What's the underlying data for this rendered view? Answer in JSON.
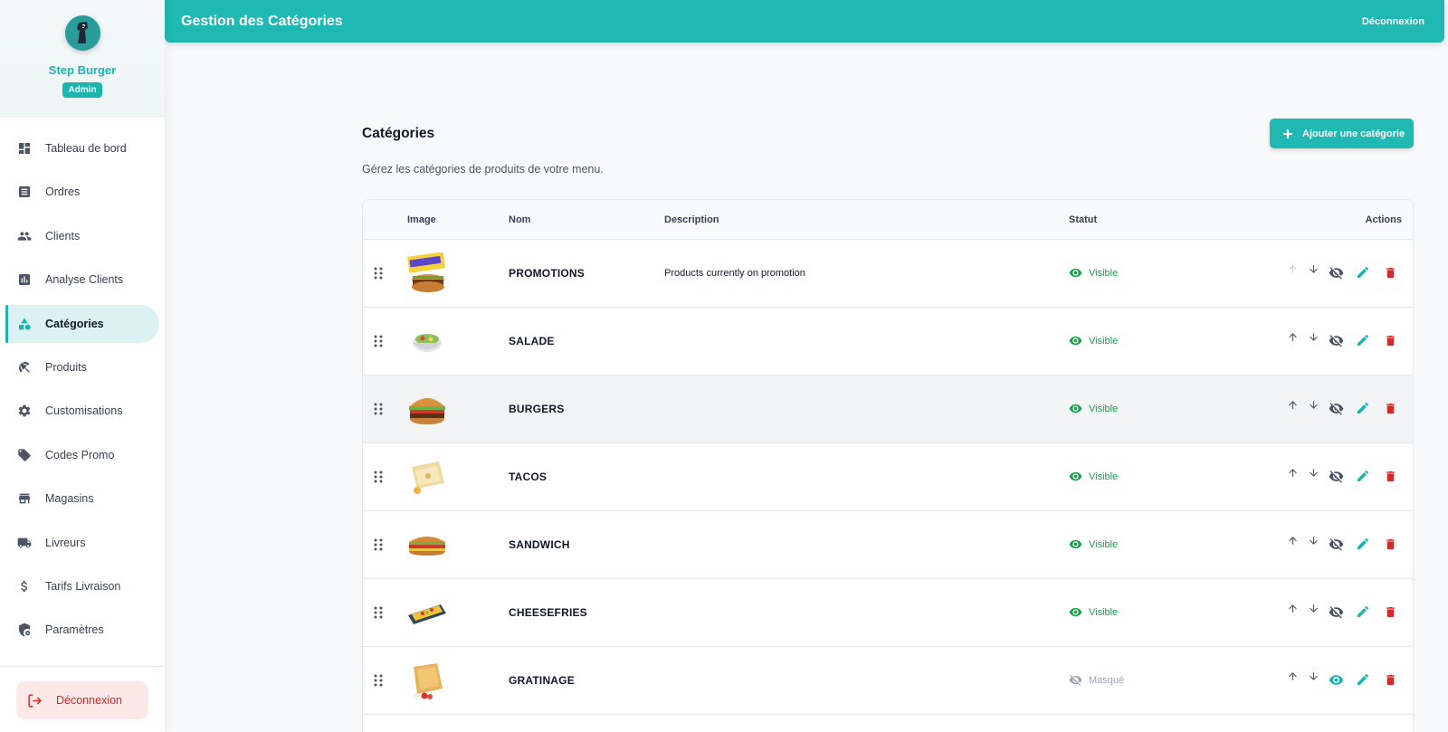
{
  "app": {
    "brand_name": "Step Burger",
    "role": "Admin",
    "page_header": "Gestion des Catégories",
    "header_logout": "Déconnexion"
  },
  "sidebar": {
    "items": [
      {
        "label": "Tableau de bord",
        "icon": "dashboard-icon"
      },
      {
        "label": "Ordres",
        "icon": "list-icon"
      },
      {
        "label": "Clients",
        "icon": "people-icon"
      },
      {
        "label": "Analyse Clients",
        "icon": "analytics-icon"
      },
      {
        "label": "Catégories",
        "icon": "category-icon",
        "active": true
      },
      {
        "label": "Produits",
        "icon": "utensils-icon"
      },
      {
        "label": "Customisations",
        "icon": "gear-icon"
      },
      {
        "label": "Codes Promo",
        "icon": "tag-icon"
      },
      {
        "label": "Magasins",
        "icon": "store-icon"
      },
      {
        "label": "Livreurs",
        "icon": "truck-icon"
      },
      {
        "label": "Tarifs Livraison",
        "icon": "dollar-icon"
      },
      {
        "label": "Paramètres",
        "icon": "admin-settings-icon"
      }
    ],
    "logout_label": "Déconnexion"
  },
  "main": {
    "title": "Catégories",
    "subtitle": "Gérez les catégories de produits de votre menu.",
    "add_button": "Ajouter une catégorie"
  },
  "table": {
    "headers": {
      "image": "Image",
      "name": "Nom",
      "description": "Description",
      "status": "Statut",
      "actions": "Actions"
    },
    "rows": [
      {
        "name": "PROMOTIONS",
        "description": "Products currently on promotion",
        "status": "Visible",
        "visible": true,
        "image": "promo"
      },
      {
        "name": "SALADE",
        "description": "",
        "status": "Visible",
        "visible": true,
        "image": "salad"
      },
      {
        "name": "BURGERS",
        "description": "",
        "status": "Visible",
        "visible": true,
        "image": "burger"
      },
      {
        "name": "TACOS",
        "description": "",
        "status": "Visible",
        "visible": true,
        "image": "tacos"
      },
      {
        "name": "SANDWICH",
        "description": "",
        "status": "Visible",
        "visible": true,
        "image": "sandwich"
      },
      {
        "name": "CHEESEFRIES",
        "description": "",
        "status": "Visible",
        "visible": true,
        "image": "fries"
      },
      {
        "name": "GRATINAGE",
        "description": "",
        "status": "Masqué",
        "visible": false,
        "image": "gratin"
      }
    ]
  },
  "colors": {
    "primary": "#1fb8b3",
    "visible": "#16a34a",
    "hidden": "#9ca3af",
    "danger": "#dc2626"
  }
}
